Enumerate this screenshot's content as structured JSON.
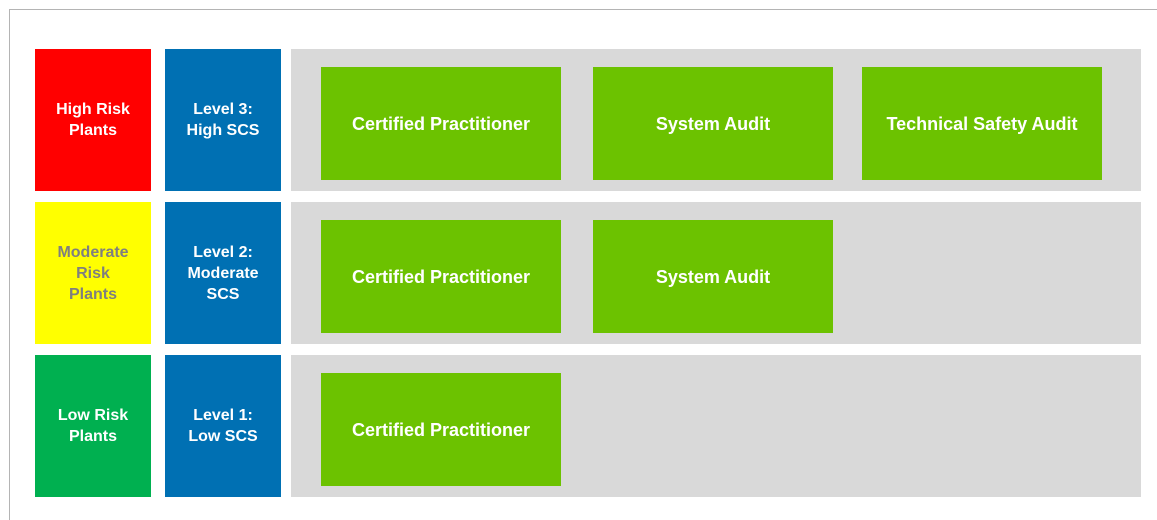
{
  "rows": [
    {
      "risk_label": "High Risk\nPlants",
      "risk_color": "#ff0000",
      "risk_text_color": "#ffffff",
      "level_label": "Level 3:\nHigh SCS",
      "requirements": [
        "Certified Practitioner",
        "System Audit",
        "Technical Safety Audit"
      ]
    },
    {
      "risk_label": "Moderate\nRisk\nPlants",
      "risk_color": "#ffff00",
      "risk_text_color": "#7f7f7f",
      "level_label": "Level 2:\nModerate\nSCS",
      "requirements": [
        "Certified Practitioner",
        "System Audit"
      ]
    },
    {
      "risk_label": "Low Risk\nPlants",
      "risk_color": "#00b050",
      "risk_text_color": "#ffffff",
      "level_label": "Level 1:\nLow SCS",
      "requirements": [
        "Certified Practitioner"
      ]
    }
  ],
  "colors": {
    "level_fill": "#0070b3",
    "band_fill": "#d9d9d9",
    "requirement_fill": "#6cc200"
  }
}
